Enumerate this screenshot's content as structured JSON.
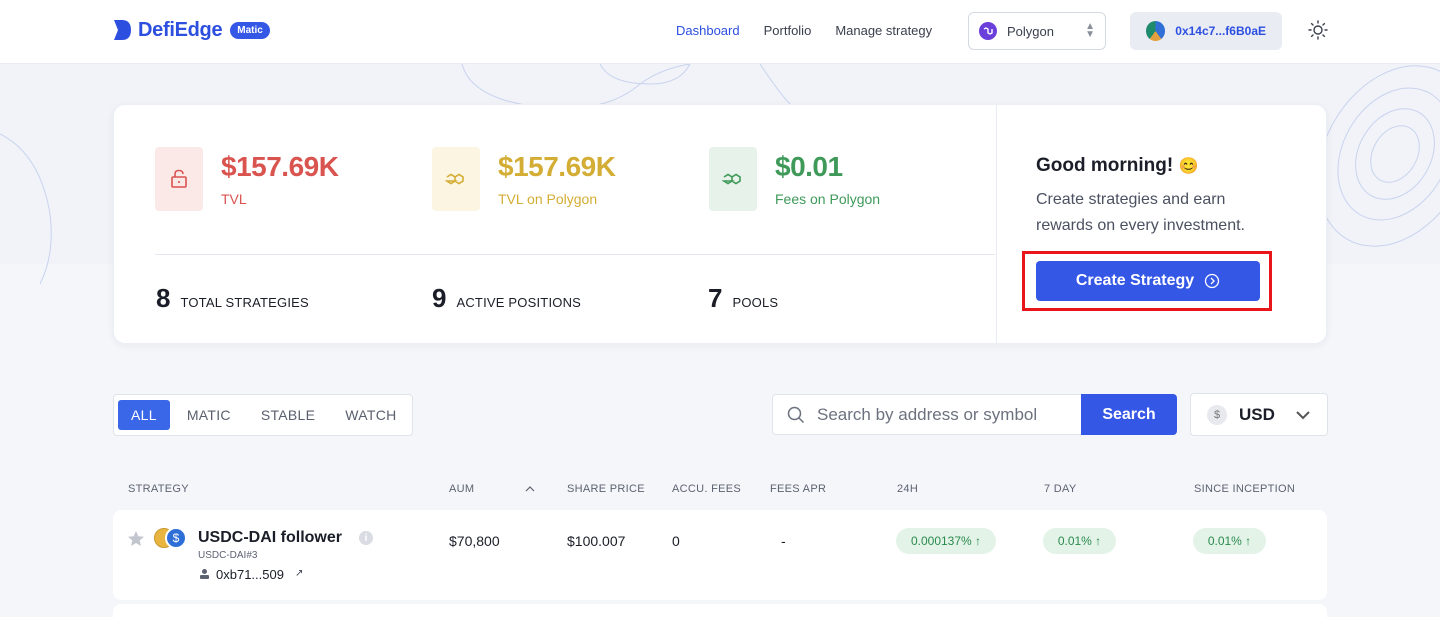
{
  "header": {
    "logo_text": "DefiEdge",
    "logo_badge": "Matic",
    "nav": [
      {
        "label": "Dashboard",
        "active": true
      },
      {
        "label": "Portfolio",
        "active": false
      },
      {
        "label": "Manage strategy",
        "active": false
      }
    ],
    "network": "Polygon",
    "wallet": "0x14c7...f6B0aE"
  },
  "stats": {
    "tvl": {
      "value": "$157.69K",
      "label": "TVL",
      "color": "#d9534f"
    },
    "tvl_polygon": {
      "value": "$157.69K",
      "label": "TVL on Polygon",
      "color": "#d4ad34"
    },
    "fees_polygon": {
      "value": "$0.01",
      "label": "Fees on Polygon",
      "color": "#3f9a5a"
    },
    "total_strategies": {
      "num": "8",
      "label": "TOTAL STRATEGIES"
    },
    "active_positions": {
      "num": "9",
      "label": "ACTIVE POSITIONS"
    },
    "pools": {
      "num": "7",
      "label": "POOLS"
    }
  },
  "greeting": {
    "title": "Good morning!",
    "emoji": "😊",
    "text": "Create strategies and earn rewards on every investment.",
    "button": "Create Strategy"
  },
  "filters": {
    "tabs": [
      {
        "label": "ALL",
        "active": true
      },
      {
        "label": "MATIC",
        "active": false
      },
      {
        "label": "STABLE",
        "active": false
      },
      {
        "label": "WATCH",
        "active": false
      }
    ],
    "search_placeholder": "Search by address or symbol",
    "search_button": "Search",
    "currency": "USD",
    "currency_symbol": "$"
  },
  "table": {
    "headers": [
      "STRATEGY",
      "AUM",
      "SHARE PRICE",
      "ACCU. FEES",
      "FEES APR",
      "24H",
      "7 DAY",
      "SINCE INCEPTION"
    ],
    "rows": [
      {
        "name": "USDC-DAI follower",
        "sub": "USDC-DAI#3",
        "address": "0xb71...509",
        "aum": "$70,800",
        "share_price": "$100.007",
        "accu_fees": "0",
        "fees_apr": "-",
        "h24": "0.000137% ↑",
        "d7": "0.01% ↑",
        "inception": "0.01% ↑"
      }
    ]
  }
}
